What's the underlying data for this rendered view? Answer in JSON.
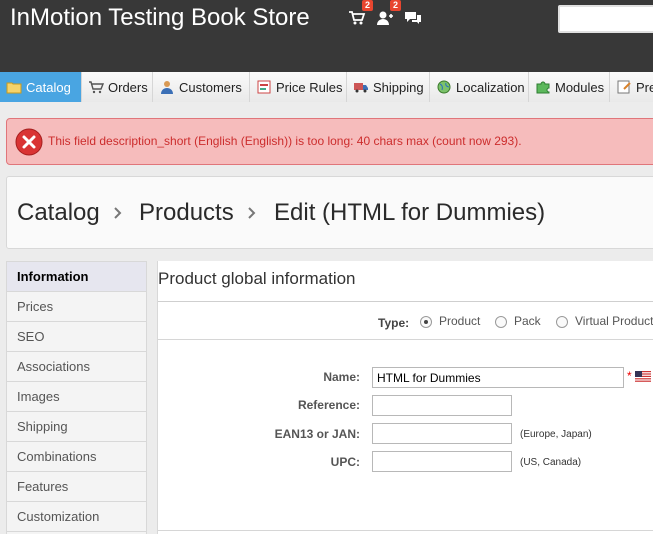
{
  "header": {
    "shop_name": "InMotion Testing Book Store",
    "orders_badge": "2",
    "customers_badge": "2"
  },
  "tabs": [
    {
      "label": "Catalog",
      "icon": "folder-icon",
      "active": true
    },
    {
      "label": "Orders",
      "icon": "cart-icon"
    },
    {
      "label": "Customers",
      "icon": "user-icon"
    },
    {
      "label": "Price Rules",
      "icon": "price-tag-icon"
    },
    {
      "label": "Shipping",
      "icon": "truck-icon"
    },
    {
      "label": "Localization",
      "icon": "globe-icon"
    },
    {
      "label": "Modules",
      "icon": "puzzle-icon"
    },
    {
      "label": "Pre",
      "icon": "preferences-icon"
    }
  ],
  "error": {
    "message": "This field description_short (English (English)) is too long: 40 chars max (count now 293)."
  },
  "breadcrumb": {
    "level1": "Catalog",
    "level2": "Products",
    "level3": "Edit (HTML for Dummies)"
  },
  "leftnav": {
    "items": [
      "Information",
      "Prices",
      "SEO",
      "Associations",
      "Images",
      "Shipping",
      "Combinations",
      "Features",
      "Customization"
    ]
  },
  "form": {
    "title": "Product global information",
    "type_label": "Type:",
    "type_options": [
      "Product",
      "Pack",
      "Virtual Product"
    ],
    "name_label": "Name:",
    "name_value": "HTML for Dummies",
    "required_mark": "*",
    "reference_label": "Reference:",
    "reference_value": "",
    "ean_label": "EAN13 or JAN:",
    "ean_value": "",
    "ean_hint": "(Europe, Japan)",
    "upc_label": "UPC:",
    "upc_value": "",
    "upc_hint": "(US, Canada)"
  },
  "colors": {
    "header_bg": "#383838",
    "active_tab": "#49a5e2",
    "error_bg": "#f6bcbc",
    "error_text": "#cc2d2d"
  }
}
